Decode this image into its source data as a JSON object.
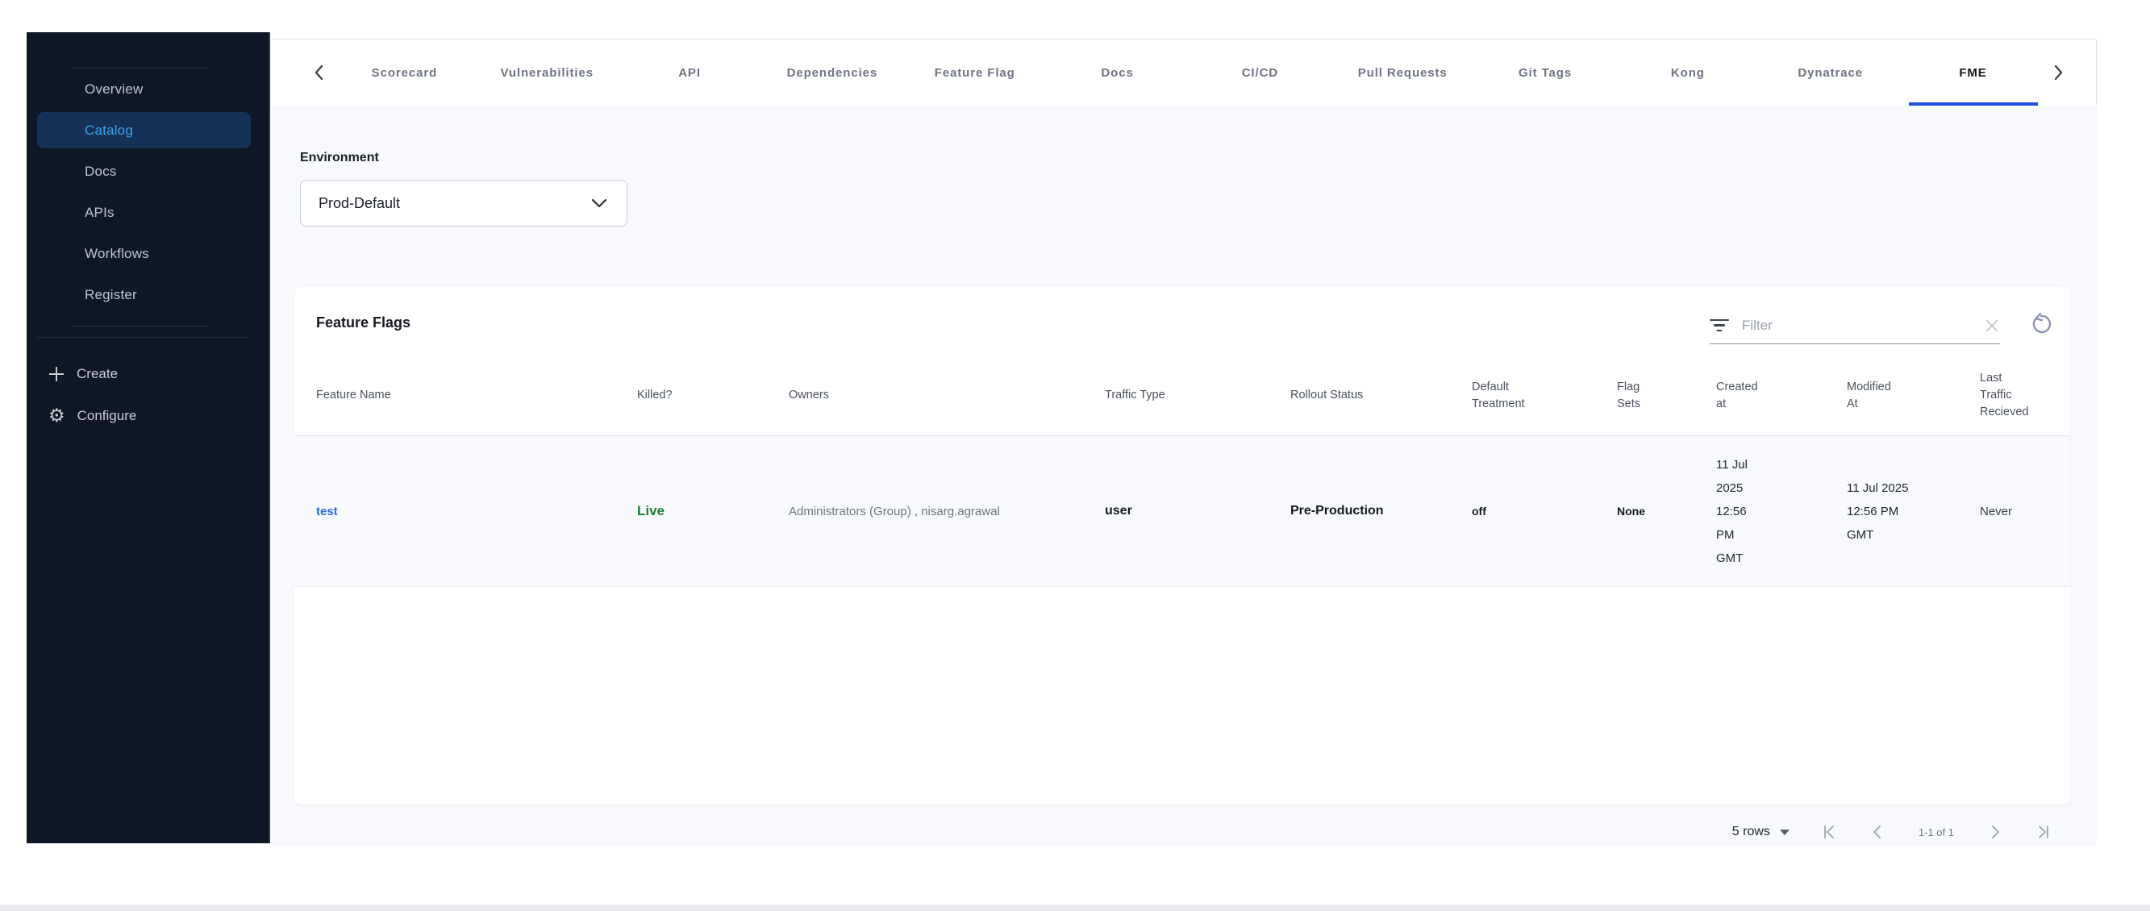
{
  "sidebar": {
    "items": [
      {
        "label": "Overview",
        "active": false
      },
      {
        "label": "Catalog",
        "active": true
      },
      {
        "label": "Docs",
        "active": false
      },
      {
        "label": "APIs",
        "active": false
      },
      {
        "label": "Workflows",
        "active": false
      },
      {
        "label": "Register",
        "active": false
      }
    ],
    "create_label": "Create",
    "configure_label": "Configure"
  },
  "tabs": {
    "items": [
      {
        "label": "Scorecard"
      },
      {
        "label": "Vulnerabilities"
      },
      {
        "label": "API"
      },
      {
        "label": "Dependencies"
      },
      {
        "label": "Feature Flag"
      },
      {
        "label": "Docs"
      },
      {
        "label": "CI/CD"
      },
      {
        "label": "Pull Requests"
      },
      {
        "label": "Git Tags"
      },
      {
        "label": "Kong"
      },
      {
        "label": "Dynatrace"
      },
      {
        "label": "FME"
      }
    ],
    "active": "FME"
  },
  "environment": {
    "label": "Environment",
    "selected_value": "Prod-Default"
  },
  "feature_flags": {
    "title": "Feature Flags",
    "filter": {
      "placeholder": "Filter",
      "value": ""
    },
    "columns": [
      "Feature Name",
      "Killed?",
      "Owners",
      "Traffic Type",
      "Rollout Status",
      "Default Treatment",
      "Flag Sets",
      "Created at",
      "Modified At",
      "Last Traffic Recieved"
    ],
    "rows": [
      {
        "feature_name": "test",
        "killed": "Live",
        "owners": "Administrators (Group) , nisarg.agrawal",
        "traffic_type": "user",
        "rollout_status": "Pre-Production",
        "default_treatment": "off",
        "flag_sets": "None",
        "created_at": "11 Jul 2025 12:56 PM GMT",
        "modified_at": "11 Jul 2025 12:56 PM GMT",
        "last_traffic_received": "Never"
      }
    ]
  },
  "pagination": {
    "rows_per_page": "5 rows",
    "range": "1-1 of 1"
  },
  "colors": {
    "sidebar_bg": "#0e1726",
    "sidebar_active_bg": "#143156",
    "sidebar_active_text": "#3aa2e8",
    "tab_active_underline": "#1c50e0",
    "link_blue": "#2d6bdf",
    "live_green": "#1e7e34",
    "content_bg": "#f7f9fc"
  }
}
